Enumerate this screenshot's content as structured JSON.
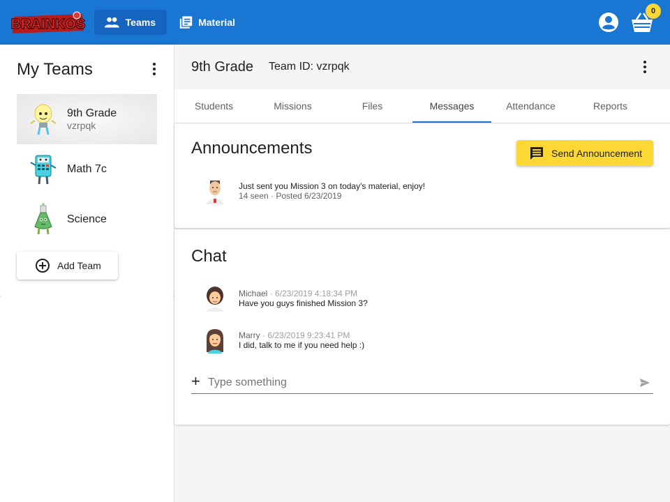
{
  "app": {
    "logo_text": "BRAINKOS",
    "nav": [
      {
        "label": "Teams",
        "active": true
      },
      {
        "label": "Material",
        "active": false
      }
    ],
    "basket_count": "0",
    "colors": {
      "primary": "#1976d2",
      "accent": "#fdd835"
    }
  },
  "sidebar": {
    "title": "My Teams",
    "teams": [
      {
        "name": "9th Grade",
        "code": "vzrpqk",
        "avatar": "lightbulb-character-icon",
        "selected": true
      },
      {
        "name": "Math 7c",
        "code": "",
        "avatar": "calculator-character-icon",
        "selected": false
      },
      {
        "name": "Science",
        "code": "",
        "avatar": "flask-character-icon",
        "selected": false
      }
    ],
    "add_team_label": "Add Team"
  },
  "team": {
    "title": "9th Grade",
    "id_label": "Team ID: vzrpqk"
  },
  "tabs": [
    {
      "label": "Students"
    },
    {
      "label": "Missions"
    },
    {
      "label": "Files"
    },
    {
      "label": "Messages",
      "active": true
    },
    {
      "label": "Attendance"
    },
    {
      "label": "Reports"
    }
  ],
  "announcements": {
    "title": "Announcements",
    "send_label": "Send Announcement",
    "items": [
      {
        "text": "Just sent you Mission 3 on today's material, enjoy!",
        "meta": "14 seen · Posted 6/23/2019"
      }
    ]
  },
  "chat": {
    "title": "Chat",
    "messages": [
      {
        "author": "Michael",
        "timestamp": " · 6/23/2019 4:18:34 PM",
        "text": "Have you guys finished Mission 3?"
      },
      {
        "author": "Marry",
        "timestamp": " · 6/23/2019 9:23:41 PM",
        "text": "I did, talk to me if you need help :)"
      }
    ],
    "input_placeholder": "Type something"
  }
}
